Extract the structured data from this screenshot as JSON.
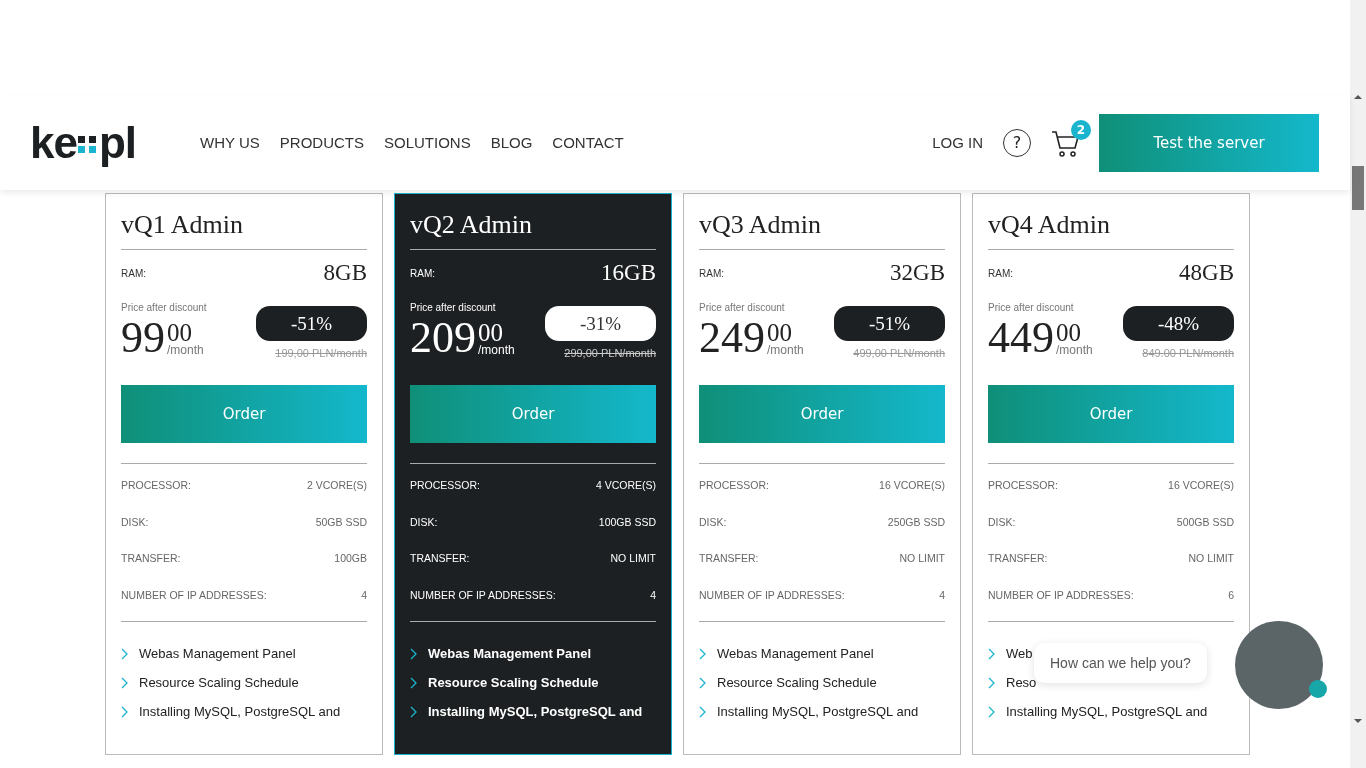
{
  "header": {
    "logo": {
      "left": "ke",
      "right": "pl"
    },
    "nav": [
      "WHY US",
      "PRODUCTS",
      "SOLUTIONS",
      "BLOG",
      "CONTACT"
    ],
    "login": "LOG IN",
    "help": "?",
    "cart_count": "2",
    "cta": "Test the server"
  },
  "plans": [
    {
      "name": "vQ1 Admin",
      "selected": false,
      "ram_label": "RAM:",
      "ram": "8GB",
      "price_label": "Price after discount",
      "price": "99",
      "cents": "00",
      "period": "/month",
      "discount": "-51%",
      "old_price": "199,00 PLN/month",
      "order": "Order",
      "specs": [
        {
          "label": "PROCESSOR:",
          "value": "2 VCORE(S)"
        },
        {
          "label": "DISK:",
          "value": "50GB SSD"
        },
        {
          "label": "TRANSFER:",
          "value": "100GB"
        },
        {
          "label": "NUMBER OF IP ADDRESSES:",
          "value": "4"
        }
      ],
      "features": [
        "Webas Management Panel",
        "Resource Scaling Schedule",
        "Installing MySQL, PostgreSQL and"
      ]
    },
    {
      "name": "vQ2 Admin",
      "selected": true,
      "ram_label": "RAM:",
      "ram": "16GB",
      "price_label": "Price after discount",
      "price": "209",
      "cents": "00",
      "period": "/month",
      "discount": "-31%",
      "old_price": "299,00 PLN/month",
      "order": "Order",
      "specs": [
        {
          "label": "PROCESSOR:",
          "value": "4 VCORE(S)"
        },
        {
          "label": "DISK:",
          "value": "100GB SSD"
        },
        {
          "label": "TRANSFER:",
          "value": "NO LIMIT"
        },
        {
          "label": "NUMBER OF IP ADDRESSES:",
          "value": "4"
        }
      ],
      "features": [
        "Webas Management Panel",
        "Resource Scaling Schedule",
        "Installing MySQL, PostgreSQL and"
      ]
    },
    {
      "name": "vQ3 Admin",
      "selected": false,
      "ram_label": "RAM:",
      "ram": "32GB",
      "price_label": "Price after discount",
      "price": "249",
      "cents": "00",
      "period": "/month",
      "discount": "-51%",
      "old_price": "499,00 PLN/month",
      "order": "Order",
      "specs": [
        {
          "label": "PROCESSOR:",
          "value": "16 VCORE(S)"
        },
        {
          "label": "DISK:",
          "value": "250GB SSD"
        },
        {
          "label": "TRANSFER:",
          "value": "NO LIMIT"
        },
        {
          "label": "NUMBER OF IP ADDRESSES:",
          "value": "4"
        }
      ],
      "features": [
        "Webas Management Panel",
        "Resource Scaling Schedule",
        "Installing MySQL, PostgreSQL and"
      ]
    },
    {
      "name": "vQ4 Admin",
      "selected": false,
      "ram_label": "RAM:",
      "ram": "48GB",
      "price_label": "Price after discount",
      "price": "449",
      "cents": "00",
      "period": "/month",
      "discount": "-48%",
      "old_price": "849.00 PLN/month",
      "order": "Order",
      "specs": [
        {
          "label": "PROCESSOR:",
          "value": "16 VCORE(S)"
        },
        {
          "label": "DISK:",
          "value": "500GB SSD"
        },
        {
          "label": "TRANSFER:",
          "value": "NO LIMIT"
        },
        {
          "label": "NUMBER OF IP ADDRESSES:",
          "value": "6"
        }
      ],
      "features": [
        "Web",
        "Reso",
        "Installing MySQL, PostgreSQL and"
      ]
    }
  ],
  "chat": {
    "message": "How can we help you?"
  }
}
